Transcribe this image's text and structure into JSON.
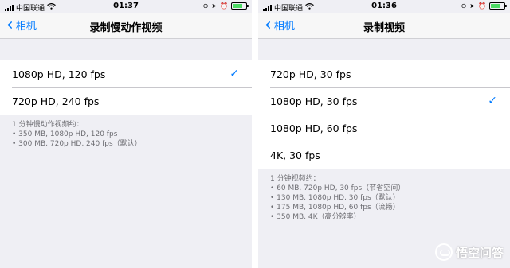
{
  "left": {
    "status": {
      "carrier": "中国联通",
      "time": "01:37",
      "battery_level": 0.75
    },
    "nav": {
      "back_label": "相机",
      "title": "录制慢动作视频"
    },
    "options": [
      {
        "label": "1080p HD, 120 fps",
        "selected": true
      },
      {
        "label": "720p HD, 240 fps",
        "selected": false
      }
    ],
    "footer_heading": "1 分钟慢动作视频约：",
    "footer_lines": [
      "• 350 MB, 1080p HD, 120 fps",
      "• 300 MB, 720p HD, 240 fps（默认）"
    ]
  },
  "right": {
    "status": {
      "carrier": "中国联通",
      "time": "01:36",
      "battery_level": 0.75
    },
    "nav": {
      "back_label": "相机",
      "title": "录制视频"
    },
    "options": [
      {
        "label": "720p HD, 30 fps",
        "selected": false
      },
      {
        "label": "1080p HD, 30 fps",
        "selected": true
      },
      {
        "label": "1080p HD, 60 fps",
        "selected": false
      },
      {
        "label": "4K, 30 fps",
        "selected": false
      }
    ],
    "footer_heading": "1 分钟视频约：",
    "footer_lines": [
      "• 60 MB, 720p HD, 30 fps（节省空间）",
      "• 130 MB, 1080p HD, 30 fps（默认）",
      "• 175 MB, 1080p HD, 60 fps（流畅）",
      "• 350 MB, 4K（高分辨率）"
    ]
  },
  "icons": {
    "back": "chevron-left-icon",
    "check": "checkmark-icon",
    "wifi": "wifi-icon",
    "signal": "signal-bars-icon",
    "battery": "battery-icon",
    "lock_rotation": "rotation-lock-icon",
    "location": "location-arrow-icon",
    "alarm": "alarm-clock-icon"
  },
  "colors": {
    "accent": "#007aff",
    "background": "#efeff4",
    "battery": "#4cd964"
  },
  "watermark": {
    "text": "悟空问答"
  }
}
